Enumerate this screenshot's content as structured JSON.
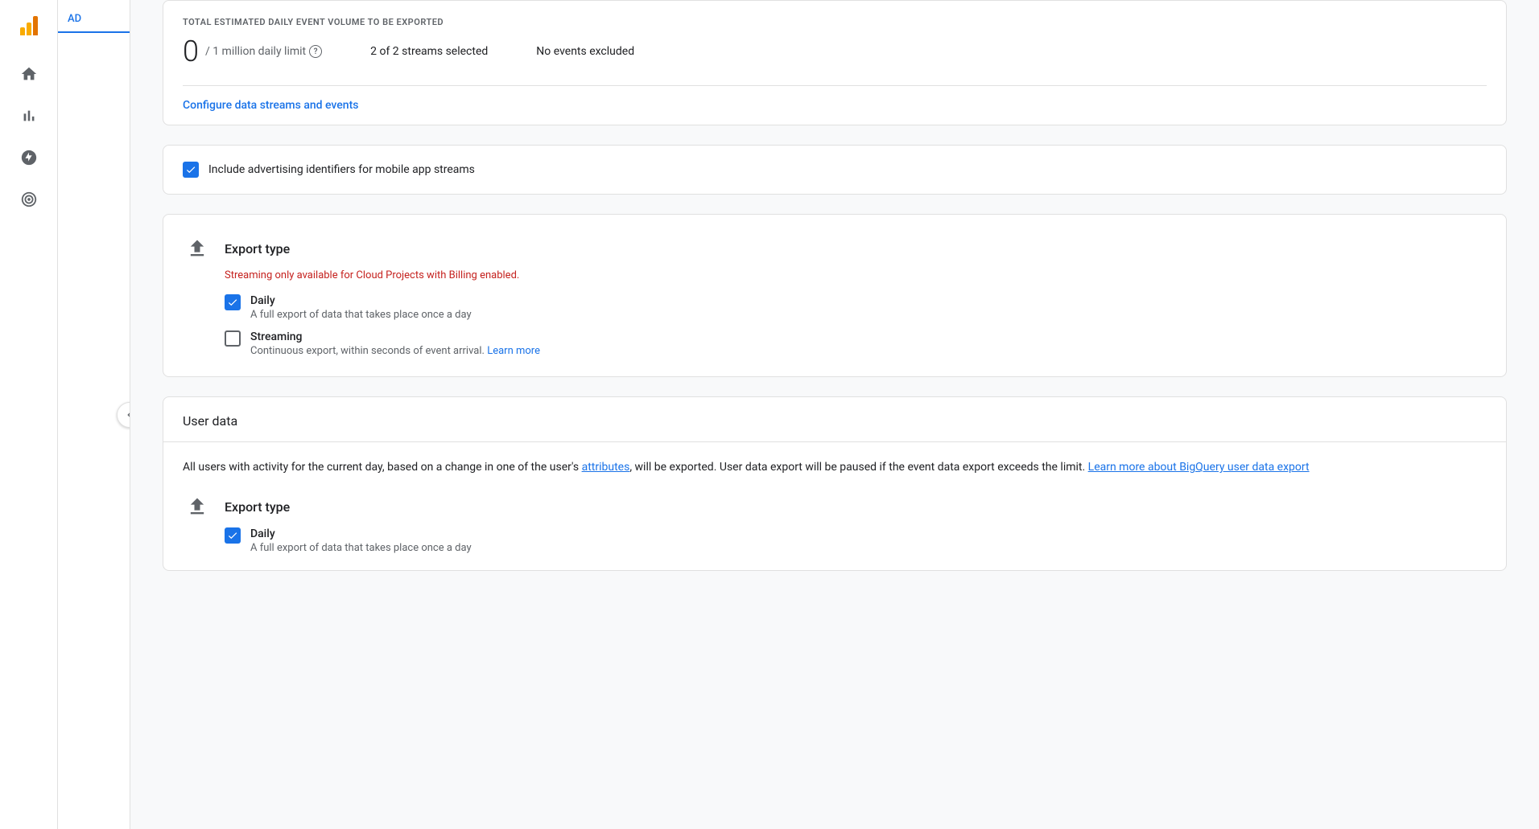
{
  "app": {
    "title": "Analytics"
  },
  "sidebar": {
    "icons": [
      {
        "name": "home-icon",
        "label": "Home"
      },
      {
        "name": "bar-chart-icon",
        "label": "Reports"
      },
      {
        "name": "explore-icon",
        "label": "Explore"
      },
      {
        "name": "advertising-icon",
        "label": "Advertising"
      }
    ]
  },
  "secondary_sidebar": {
    "tab_label": "AD"
  },
  "event_volume": {
    "title": "TOTAL ESTIMATED DAILY EVENT VOLUME TO BE EXPORTED",
    "value": "0",
    "limit_text": "/ 1 million daily limit",
    "streams_selected": "2 of 2 streams selected",
    "no_events_excluded": "No events excluded",
    "configure_link": "Configure data streams and events"
  },
  "advertising_checkbox": {
    "label": "Include advertising identifiers for mobile app streams",
    "checked": true
  },
  "export_type_section": {
    "title": "Export type",
    "warning": "Streaming only available for Cloud Projects with Billing enabled.",
    "options": [
      {
        "label": "Daily",
        "description": "A full export of data that takes place once a day",
        "checked": true,
        "has_learn_more": false
      },
      {
        "label": "Streaming",
        "description": "Continuous export, within seconds of event arrival.",
        "checked": false,
        "has_learn_more": true,
        "learn_more_text": "Learn more"
      }
    ]
  },
  "user_data_section": {
    "title": "User data",
    "description_before": "All users with activity for the current day, based on a change in one of the user's ",
    "attributes_link": "attributes",
    "description_after": ", will be exported. User data export will be paused if the event data export exceeds the limit.",
    "learn_more_link": "Learn more about BigQuery user data export",
    "export_type": {
      "title": "Export type",
      "options": [
        {
          "label": "Daily",
          "description": "A full export of data that takes place once a day",
          "checked": true
        }
      ]
    }
  }
}
